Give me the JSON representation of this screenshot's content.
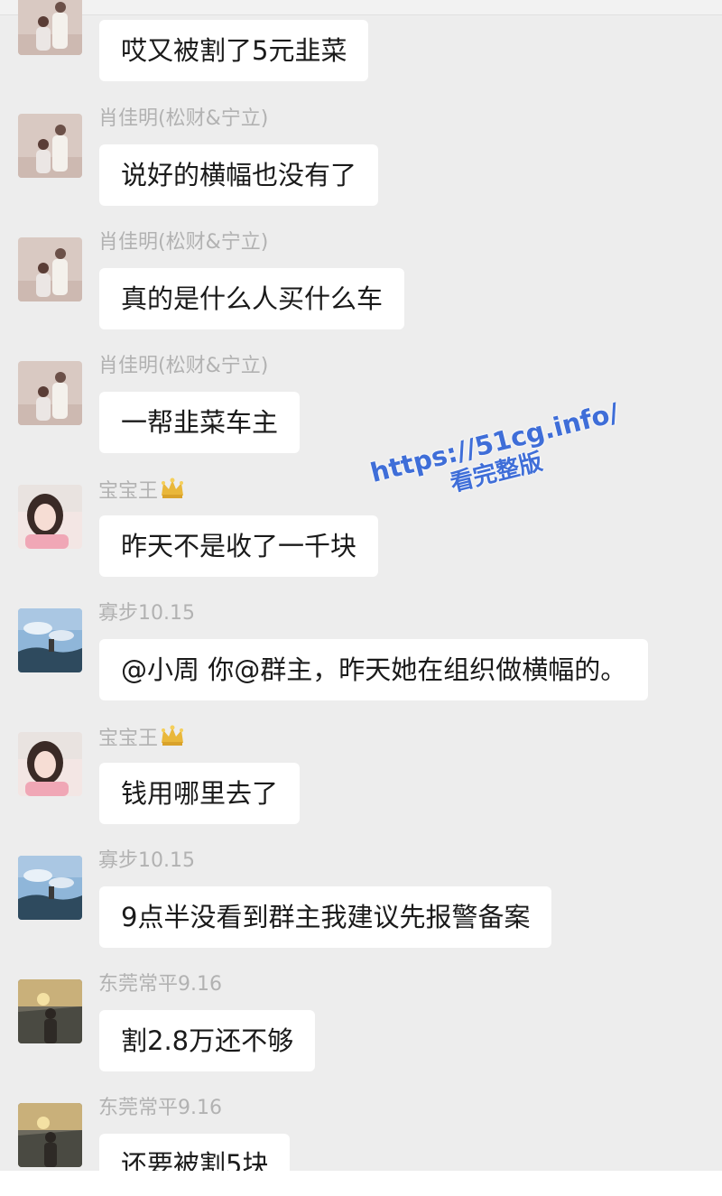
{
  "messages": [
    {
      "sender": "",
      "text": "哎又被割了5元韭菜",
      "avatar": "couple-photo"
    },
    {
      "sender": "肖佳明(松财&宁立)",
      "text": "说好的横幅也没有了",
      "avatar": "couple-photo"
    },
    {
      "sender": "肖佳明(松财&宁立)",
      "text": "真的是什么人买什么车",
      "avatar": "couple-photo"
    },
    {
      "sender": "肖佳明(松财&宁立)",
      "text": "一帮韭菜车主",
      "avatar": "couple-photo"
    },
    {
      "sender": "宝宝王",
      "text": "昨天不是收了一千块",
      "avatar": "girl-selfie",
      "crown": true
    },
    {
      "sender": "寡步10.15",
      "text": "@小周 你@群主，昨天她在组织做横幅的。",
      "avatar": "sky-landscape"
    },
    {
      "sender": "宝宝王",
      "text": "钱用哪里去了",
      "avatar": "girl-selfie",
      "crown": true
    },
    {
      "sender": "寡步10.15",
      "text": "9点半没看到群主我建议先报警备案",
      "avatar": "sky-landscape"
    },
    {
      "sender": "东莞常平9.16",
      "text": "割2.8万还不够",
      "avatar": "sunset-person"
    },
    {
      "sender": "东莞常平9.16",
      "text": "还要被割5块",
      "avatar": "sunset-person"
    }
  ],
  "watermark": {
    "url": "https://51cg.info/",
    "text": "看完整版",
    "color": "#3f6ed8"
  },
  "colors": {
    "background": "#ededed",
    "bubble": "#ffffff",
    "sender_name": "#b2b2b2",
    "message_text": "#1a1a1a"
  }
}
